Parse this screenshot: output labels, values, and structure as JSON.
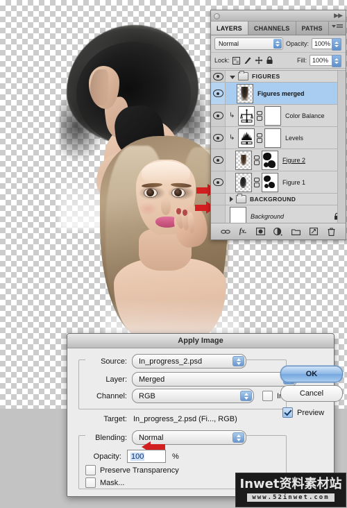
{
  "app": {
    "name": "Adobe Photoshop",
    "canvas": {
      "artwork_description": "Two fashion model photos composited on transparent checkerboard background"
    }
  },
  "layers_panel": {
    "title": "Layers",
    "tabs": [
      {
        "label": "LAYERS",
        "active": true
      },
      {
        "label": "CHANNELS",
        "active": false
      },
      {
        "label": "PATHS",
        "active": false
      }
    ],
    "blend_mode": "Normal",
    "opacity_label": "Opacity:",
    "opacity_value": "100%",
    "lock_label": "Lock:",
    "fill_label": "Fill:",
    "fill_value": "100%",
    "lock_icons": [
      "lock-transparent-pixels",
      "lock-image-pixels",
      "lock-position",
      "lock-all"
    ],
    "rows": [
      {
        "kind": "group",
        "name": "FIGURES",
        "visible": true,
        "expanded": true,
        "selected": false
      },
      {
        "kind": "layer",
        "name": "Figures merged",
        "visible": true,
        "selected": true,
        "thumb": "figures-merged-thumbnail",
        "style": "bold"
      },
      {
        "kind": "adjustment",
        "name": "Color Balance",
        "visible": true,
        "selected": false,
        "clipped": true,
        "icon": "color-balance-icon",
        "mask": "white"
      },
      {
        "kind": "adjustment",
        "name": "Levels",
        "visible": true,
        "selected": false,
        "clipped": true,
        "icon": "levels-icon",
        "mask": "white"
      },
      {
        "kind": "layer",
        "name": "Figure 2",
        "visible": true,
        "selected": false,
        "thumb": "figure-2-thumbnail",
        "mask": "figure-2-layer-mask",
        "style": "underline"
      },
      {
        "kind": "layer",
        "name": "Figure 1",
        "visible": true,
        "selected": false,
        "thumb": "figure-1-thumbnail",
        "mask": "figure-1-layer-mask"
      },
      {
        "kind": "group",
        "name": "BACKGROUND",
        "visible": false,
        "expanded": false,
        "selected": false
      },
      {
        "kind": "layer",
        "name": "Background",
        "visible": false,
        "selected": false,
        "locked": true,
        "thumb": "white-background-thumbnail",
        "style": "italic"
      }
    ],
    "footer_buttons": [
      "link-layers-icon",
      "layer-style-fx-icon",
      "add-layer-mask-icon",
      "new-adjustment-layer-icon",
      "new-group-icon",
      "new-layer-icon",
      "delete-layer-icon"
    ]
  },
  "apply_image_dialog": {
    "title": "Apply Image",
    "source_label": "Source:",
    "source_value": "In_progress_2.psd",
    "layer_label": "Layer:",
    "layer_value": "Merged",
    "channel_label": "Channel:",
    "channel_value": "RGB",
    "invert_label": "Invert",
    "invert_checked": false,
    "target_label": "Target:",
    "target_value": "In_progress_2.psd (Fi..., RGB)",
    "blending_label": "Blending:",
    "blending_value": "Normal",
    "opacity_label": "Opacity:",
    "opacity_value": "100",
    "percent_symbol": "%",
    "preserve_transparency_label": "Preserve Transparency",
    "preserve_transparency_checked": false,
    "mask_label": "Mask...",
    "mask_checked": false,
    "ok_label": "OK",
    "cancel_label": "Cancel",
    "preview_label": "Preview",
    "preview_checked": true
  },
  "annotations": {
    "arrow_color": "#d21f1f",
    "canvas_arrows": 2,
    "dialog_arrow_target": "blending-dropdown"
  },
  "watermark": {
    "main": "Inwet资料素材站",
    "sub": "www.52inwet.com"
  }
}
